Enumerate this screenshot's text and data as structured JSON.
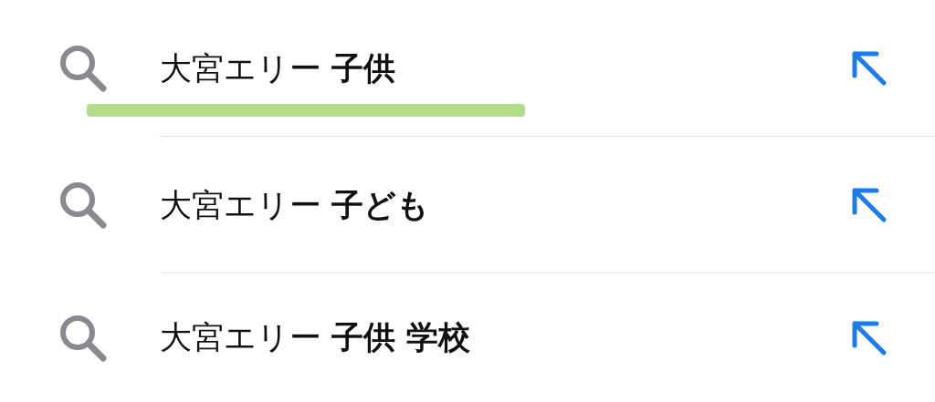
{
  "suggestions": [
    {
      "text": "大宮エリー **子供**",
      "highlighted": true
    },
    {
      "text": "大宮エリー **子ども**",
      "highlighted": false
    },
    {
      "text": "大宮エリー **子供 学校**",
      "highlighted": false
    }
  ]
}
